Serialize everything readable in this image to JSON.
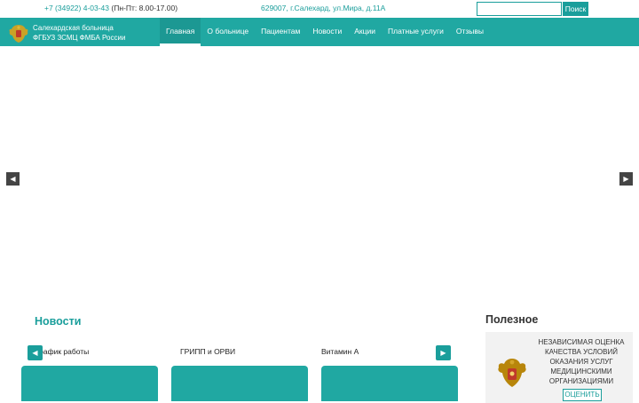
{
  "topbar": {
    "phone_number": "+7 (34922) 4-03-43",
    "phone_hours": " (Пн-Пт: 8.00-17.00)",
    "address": "629007, г.Салехард, ул.Мира, д.11А",
    "search_placeholder": "",
    "search_button": "Поиск"
  },
  "header": {
    "brand_line1": "Салехардская больница",
    "brand_line2": "ФГБУЗ ЗСМЦ ФМБА России",
    "logo_icon": "coat-of-arms-icon"
  },
  "nav": {
    "items": [
      {
        "label": "Главная",
        "active": true
      },
      {
        "label": "О больнице",
        "active": false
      },
      {
        "label": "Пациентам",
        "active": false
      },
      {
        "label": "Новости",
        "active": false
      },
      {
        "label": "Акции",
        "active": false
      },
      {
        "label": "Платные услуги",
        "active": false
      },
      {
        "label": "Отзывы",
        "active": false
      }
    ]
  },
  "slider": {
    "prev_icon": "chevron-left-icon",
    "next_icon": "chevron-right-icon"
  },
  "news": {
    "title": "Новости",
    "cards": [
      {
        "title": "График работы"
      },
      {
        "title": "ГРИПП и ОРВИ"
      },
      {
        "title": "Витамин А"
      }
    ]
  },
  "useful": {
    "title": "Полезное",
    "text": "НЕЗАВИСИМАЯ ОЦЕНКА КАЧЕСТВА УСЛОВИЙ ОКАЗАНИЯ УСЛУГ МЕДИЦИНСКИМИ ОРГАНИЗАЦИЯМИ",
    "button": "ОЦЕНИТЬ",
    "emblem_icon": "double-headed-eagle-emblem-icon"
  },
  "colors": {
    "accent": "#20a8a2",
    "accent_dark": "#1a9e9b"
  }
}
